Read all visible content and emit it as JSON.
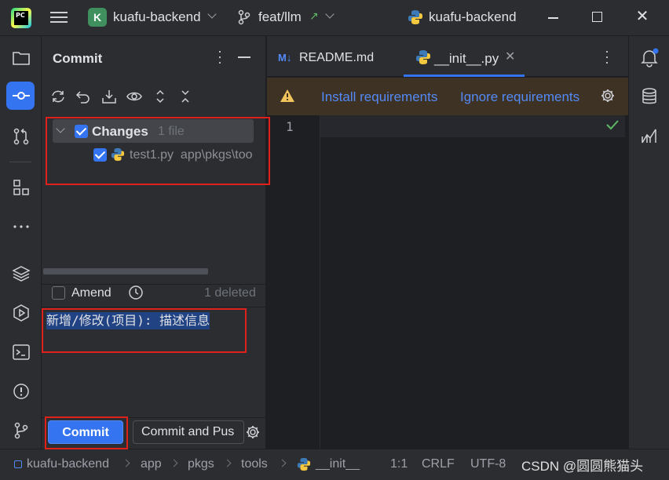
{
  "titlebar": {
    "project_initial": "K",
    "project_name": "kuafu-backend",
    "branch_name": "feat/llm",
    "branch_arrow": "↗",
    "window_title": "kuafu-backend",
    "close_glyph": "✕"
  },
  "commit_panel": {
    "title": "Commit",
    "changes_label": "Changes",
    "changes_count": "1 file",
    "file_name": "test1.py",
    "file_path": "app\\pkgs\\too",
    "amend_label": "Amend",
    "deleted_label": "1 deleted",
    "message": "新增/修改(项目): 描述信息",
    "commit_button": "Commit",
    "commit_push_button": "Commit and Pus"
  },
  "editor": {
    "tab1_badge": "M↓",
    "tab1_label": "README.md",
    "tab2_label": "__init__.py",
    "tab2_close": "✕",
    "banner_link_install": "Install requirements",
    "banner_link_ignore": "Ignore requirements",
    "line_number": "1"
  },
  "statusbar": {
    "crumb_project": "kuafu-backend",
    "crumb_app": "app",
    "crumb_pkgs": "pkgs",
    "crumb_tools": "tools",
    "crumb_file": "__init__",
    "position": "1:1",
    "line_sep": "CRLF",
    "encoding": "UTF-8"
  },
  "watermark": "CSDN @圆圆熊猫头",
  "colors": {
    "accent": "#3574f0",
    "annotation_red": "#e0201b",
    "warning_banner": "#3d3223",
    "link": "#548af7"
  }
}
